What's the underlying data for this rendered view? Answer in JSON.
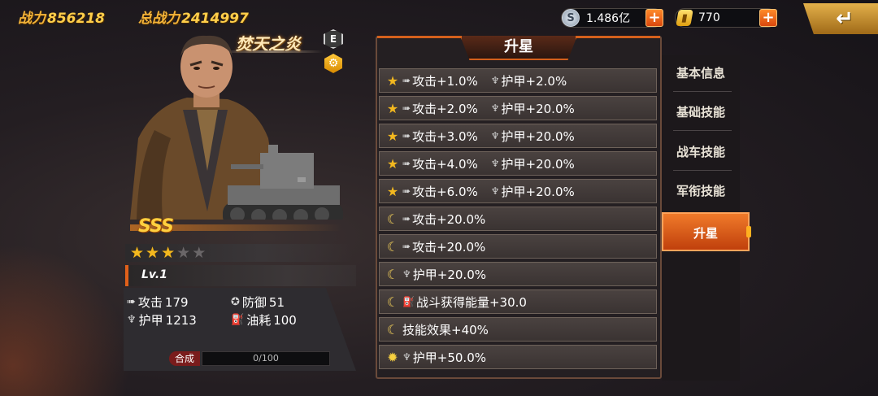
{
  "header": {
    "power_label": "战力",
    "power_value": "856218",
    "total_power_label": "总战力",
    "total_power_value": "2414997",
    "silver": {
      "icon": "silver-coin-icon",
      "value": "1.486亿",
      "add": "+"
    },
    "gold": {
      "icon": "gold-bar-icon",
      "value": "770",
      "add": "+"
    },
    "back_glyph": "↵"
  },
  "character": {
    "name": "焚天之炎",
    "badge_letter": "E",
    "badge_icon": "gear-badge-icon",
    "rank": "SSS",
    "stars": {
      "filled": 3,
      "total": 5
    },
    "level": "Lv.1",
    "stats": {
      "attack_label": "攻击",
      "attack_value": "179",
      "defense_label": "防御",
      "defense_value": "51",
      "armor_label": "护甲",
      "armor_value": "1213",
      "fuel_label": "油耗",
      "fuel_value": "100"
    },
    "merge_label": "合成",
    "merge_progress_text": "0/100",
    "merge_progress": 0
  },
  "panel": {
    "title": "升星",
    "rows": [
      {
        "icon": "star",
        "effects": [
          {
            "icon": "attack-icon",
            "text": "攻击+1.0%"
          },
          {
            "icon": "armor-icon",
            "text": "护甲+2.0%"
          }
        ]
      },
      {
        "icon": "star",
        "effects": [
          {
            "icon": "attack-icon",
            "text": "攻击+2.0%"
          },
          {
            "icon": "armor-icon",
            "text": "护甲+20.0%"
          }
        ]
      },
      {
        "icon": "star",
        "effects": [
          {
            "icon": "attack-icon",
            "text": "攻击+3.0%"
          },
          {
            "icon": "armor-icon",
            "text": "护甲+20.0%"
          }
        ]
      },
      {
        "icon": "star",
        "effects": [
          {
            "icon": "attack-icon",
            "text": "攻击+4.0%"
          },
          {
            "icon": "armor-icon",
            "text": "护甲+20.0%"
          }
        ]
      },
      {
        "icon": "star",
        "effects": [
          {
            "icon": "attack-icon",
            "text": "攻击+6.0%"
          },
          {
            "icon": "armor-icon",
            "text": "护甲+20.0%"
          }
        ]
      },
      {
        "icon": "moon",
        "effects": [
          {
            "icon": "attack-icon",
            "text": "攻击+20.0%"
          }
        ]
      },
      {
        "icon": "moon",
        "effects": [
          {
            "icon": "attack-icon",
            "text": "攻击+20.0%"
          }
        ]
      },
      {
        "icon": "moon",
        "effects": [
          {
            "icon": "armor-icon",
            "text": "护甲+20.0%"
          }
        ]
      },
      {
        "icon": "moon",
        "effects": [
          {
            "icon": "fuel-icon",
            "text": "战斗获得能量+30.0"
          }
        ]
      },
      {
        "icon": "moon",
        "effects": [
          {
            "icon": "",
            "text": "技能效果+40%"
          }
        ]
      },
      {
        "icon": "sun",
        "effects": [
          {
            "icon": "armor-icon",
            "text": "护甲+50.0%"
          }
        ]
      }
    ]
  },
  "tabs": [
    {
      "label": "基本信息",
      "active": false
    },
    {
      "label": "基础技能",
      "active": false
    },
    {
      "label": "战车技能",
      "active": false
    },
    {
      "label": "军衔技能",
      "active": false
    },
    {
      "label": "升星",
      "active": true
    }
  ]
}
